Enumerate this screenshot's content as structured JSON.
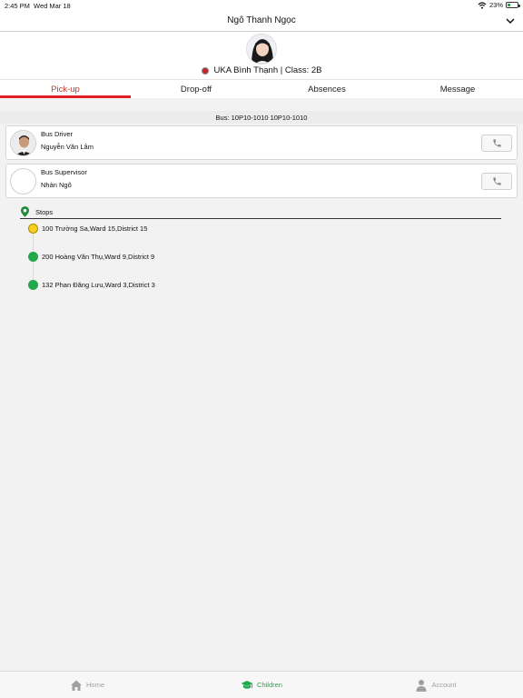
{
  "status_bar": {
    "time": "2:45 PM",
    "date": "Wed Mar 18",
    "battery": "23%"
  },
  "header": {
    "student_name": "Ngô Thanh Ngọc"
  },
  "profile": {
    "school_class": "UKA Bình Thạnh | Class: 2B"
  },
  "tabs": [
    {
      "label": "Pick-up",
      "active": true
    },
    {
      "label": "Drop-off",
      "active": false
    },
    {
      "label": "Absences",
      "active": false
    },
    {
      "label": "Message",
      "active": false
    }
  ],
  "bus": {
    "label": "Bus: 10P10-1010 10P10-1010"
  },
  "contacts": [
    {
      "role": "Bus Driver",
      "name": "Nguyễn Văn Lâm"
    },
    {
      "role": "Bus Supervisor",
      "name": "Nhàn Ngô"
    }
  ],
  "stops": {
    "label": "Stops",
    "items": [
      {
        "address": "100 Trường Sa,Ward 15,District 15",
        "current": true
      },
      {
        "address": "200 Hoàng Văn Thụ,Ward 9,District 9",
        "current": false
      },
      {
        "address": "132 Phan Đăng Lưu,Ward 3,District 3",
        "current": false
      }
    ]
  },
  "bottom_nav": [
    {
      "label": "Home",
      "icon": "home-icon",
      "active": false
    },
    {
      "label": "Children",
      "icon": "graduation-cap-icon",
      "active": true
    },
    {
      "label": "Account",
      "icon": "person-icon",
      "active": false
    }
  ],
  "colors": {
    "accent_red": "#e02020",
    "stop_green": "#22a84a",
    "stop_current": "#f5d020"
  }
}
